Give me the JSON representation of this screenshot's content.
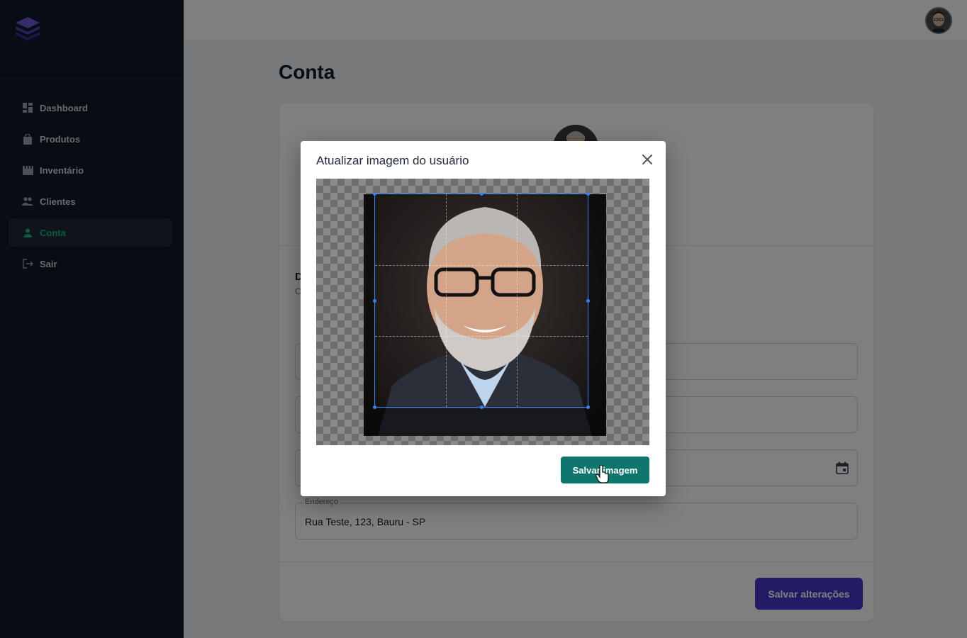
{
  "sidebar": {
    "logo_icon": "layers-icon",
    "items": [
      {
        "label": "Dashboard",
        "icon": "dashboard-icon",
        "active": false
      },
      {
        "label": "Produtos",
        "icon": "bag-icon",
        "active": false
      },
      {
        "label": "Inventário",
        "icon": "inventory-icon",
        "active": false
      },
      {
        "label": "Clientes",
        "icon": "users-icon",
        "active": false
      },
      {
        "label": "Conta",
        "icon": "user-icon",
        "active": true
      },
      {
        "label": "Sair",
        "icon": "logout-icon",
        "active": false
      }
    ]
  },
  "page": {
    "title": "Conta"
  },
  "form": {
    "section_title": "D",
    "section_sub": "C",
    "address_label": "Endereço",
    "address_value": "Rua Teste, 123, Bauru - SP",
    "save_label": "Salvar alterações"
  },
  "modal": {
    "title": "Atualizar imagem do usuário",
    "save_label": "Salvar imagem"
  },
  "colors": {
    "sidebar_bg": "#111827",
    "accent_active": "#10b981",
    "primary_button": "#4338ca",
    "modal_button": "#0f766e",
    "crop_border": "#3b82f6"
  }
}
